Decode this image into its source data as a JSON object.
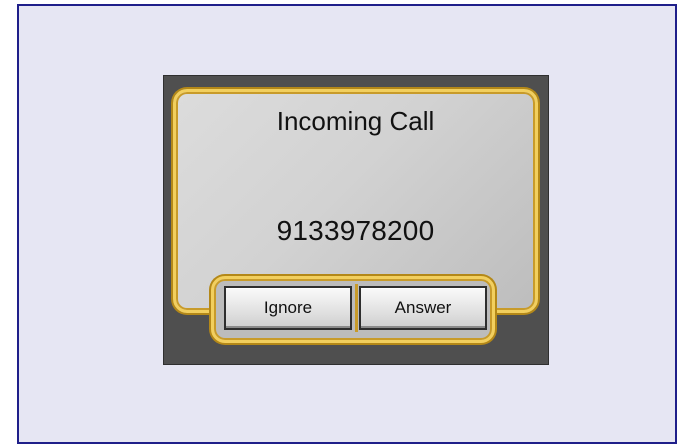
{
  "dialog": {
    "title": "Incoming Call",
    "phone_number": "9133978200"
  },
  "buttons": {
    "ignore_label": "Ignore",
    "answer_label": "Answer"
  },
  "colors": {
    "frame_background": "#e6e6f3",
    "frame_border": "#1f1f8a",
    "panel_background": "#4f4f4f",
    "accent_gold": "#f2cf5e"
  }
}
